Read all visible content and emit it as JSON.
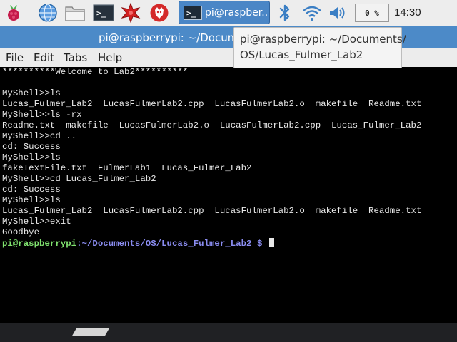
{
  "taskbar": {
    "launchers": [
      "raspberry-menu-icon",
      "web-browser-icon",
      "file-manager-icon",
      "terminal-icon",
      "mathematica-icon",
      "wolfram-icon"
    ],
    "task_button_label": "pi@raspber...",
    "tray": [
      "bluetooth-icon",
      "wifi-icon",
      "volume-icon"
    ],
    "cpu_text": "0 %",
    "clock": "14:30"
  },
  "window": {
    "title": "pi@raspberrypi: ~/Documents/OS/Lucas_Fulmer_Lab2",
    "menu": [
      "File",
      "Edit",
      "Tabs",
      "Help"
    ]
  },
  "tooltip": {
    "line1": "pi@raspberrypi: ~/Documents/",
    "line2": "OS/Lucas_Fulmer_Lab2"
  },
  "terminal": {
    "lines": [
      "**********Welcome to Lab2**********",
      "",
      "MyShell>>ls",
      "Lucas_Fulmer_Lab2  LucasFulmerLab2.cpp  LucasFulmerLab2.o  makefile  Readme.txt",
      "MyShell>>ls -rx",
      "Readme.txt  makefile  LucasFulmerLab2.o  LucasFulmerLab2.cpp  Lucas_Fulmer_Lab2",
      "MyShell>>cd ..",
      "cd: Success",
      "MyShell>>ls",
      "fakeTextFile.txt  FulmerLab1  Lucas_Fulmer_Lab2",
      "MyShell>>cd Lucas_Fulmer_Lab2",
      "cd: Success",
      "MyShell>>ls",
      "Lucas_Fulmer_Lab2  LucasFulmerLab2.cpp  LucasFulmerLab2.o  makefile  Readme.txt",
      "MyShell>>exit",
      "Goodbye"
    ],
    "prompt_user": "pi@raspberrypi",
    "prompt_sep": ":",
    "prompt_path": "~/Documents/OS/Lucas_Fulmer_Lab2",
    "prompt_dollar": "$"
  },
  "colors": {
    "titlebar": "#4c8ac8",
    "prompt_user": "#7fe06e",
    "prompt_path": "#8a8cf0"
  }
}
